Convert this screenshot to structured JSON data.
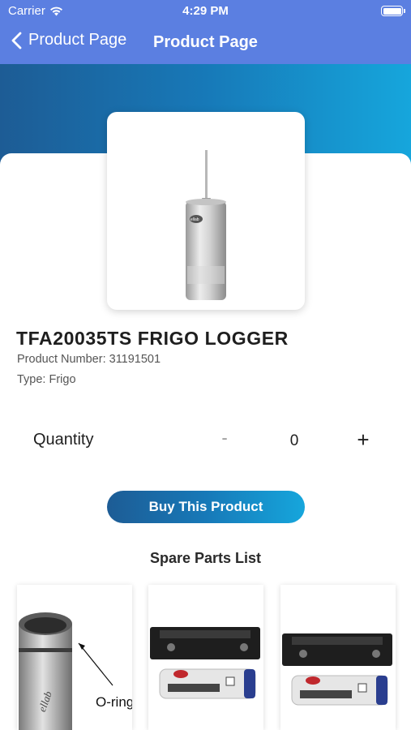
{
  "status_bar": {
    "carrier": "Carrier",
    "time": "4:29 PM"
  },
  "nav": {
    "back_label": "Product Page",
    "title": "Product Page"
  },
  "colors": {
    "nav_bg": "#5b7fe1",
    "gradient_start": "#1d5c95",
    "gradient_end": "#16a6dc"
  },
  "product": {
    "title": "TFA20035TS FRIGO LOGGER",
    "number": "Product Number: 31191501",
    "type": "Type: Frigo"
  },
  "quantity": {
    "label": "Quantity",
    "minus": "-",
    "value": "0",
    "plus": "+"
  },
  "buy_button": "Buy This Product",
  "spare_parts": {
    "title": "Spare Parts List",
    "items": [
      {
        "icon": "o-ring-image",
        "caption": "O-ring"
      },
      {
        "icon": "battery-holder-image"
      },
      {
        "icon": "battery-holder-image"
      }
    ]
  }
}
